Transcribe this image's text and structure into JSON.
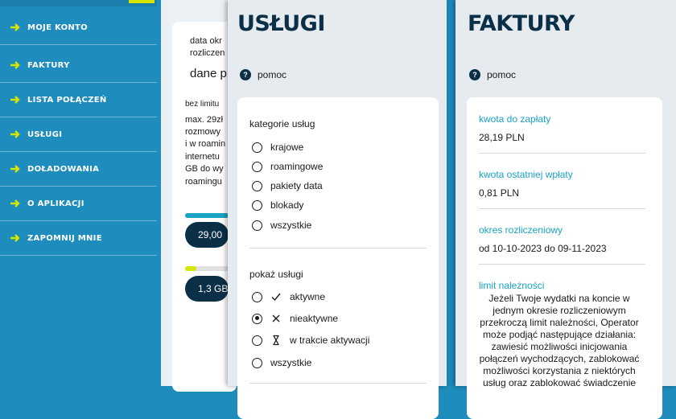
{
  "sidebar": {
    "items": [
      {
        "label": "MOJE KONTO"
      },
      {
        "label": "FAKTURY"
      },
      {
        "label": "LISTA POŁĄCZEŃ"
      },
      {
        "label": "USŁUGI"
      },
      {
        "label": "DOŁADOWANIA"
      },
      {
        "label": "O APLIKACJI"
      },
      {
        "label": "ZAPOMNIJ MNIE"
      }
    ],
    "accent_color": "#d5e600"
  },
  "background_page": {
    "line1": "data okr",
    "line2": "rozliczen",
    "line3": "dane p",
    "line4": "bez limitu",
    "line5": "max. 29zł",
    "line6": "rozmowy",
    "line7": "i w roamin",
    "line8": "internetu",
    "line9": "GB do wy",
    "line10": "roamingu",
    "pill1": "29,00",
    "pill2": "1,3 GB"
  },
  "services": {
    "title": "USŁUGI",
    "help": "pomoc",
    "categories_title": "kategorie usług",
    "categories": [
      {
        "label": "krajowe",
        "selected": false
      },
      {
        "label": "roamingowe",
        "selected": false
      },
      {
        "label": "pakiety data",
        "selected": false
      },
      {
        "label": "blokady",
        "selected": false
      },
      {
        "label": "wszystkie",
        "selected": false
      }
    ],
    "show_title": "pokaż usługi",
    "show": [
      {
        "label": "aktywne",
        "icon": "check-icon",
        "selected": false
      },
      {
        "label": "nieaktywne",
        "icon": "x-icon",
        "selected": true
      },
      {
        "label": "w trakcie aktywacji",
        "icon": "hourglass-icon",
        "selected": false
      },
      {
        "label": "wszystkie",
        "icon": "",
        "selected": false
      }
    ]
  },
  "invoices": {
    "title": "FAKTURY",
    "help": "pomoc",
    "amount_due_label": "kwota do zapłaty",
    "amount_due": "28,19 PLN",
    "last_payment_label": "kwota ostatniej wpłaty",
    "last_payment": "0,81 PLN",
    "period_label": "okres rozliczeniowy",
    "period": "od 10-10-2023 do 09-11-2023",
    "limit_label": "limit należności",
    "limit_text": [
      "Jeżeli Twoje wydatki na koncie w",
      "jednym okresie rozliczeniowym",
      "przekroczą limit należności, Operator",
      "może podjąć następujące działania:",
      "zawiesić możliwości inicjowania",
      "połączeń wychodzących, zablokować",
      "możliwości korzystania z niektórych",
      "usług oraz zablokować świadczenie"
    ]
  },
  "colors": {
    "navy": "#0c2f48",
    "teal": "#1aa3c4",
    "sidebar": "#1e8cbd"
  }
}
